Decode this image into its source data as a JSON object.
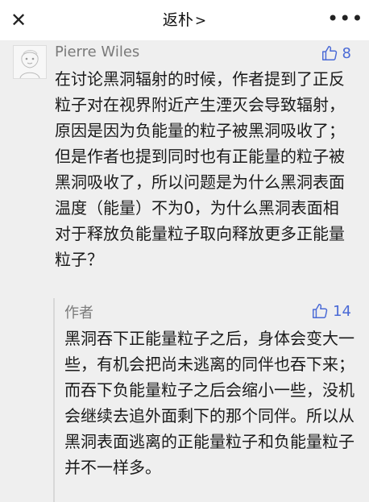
{
  "header": {
    "title": "返朴",
    "chevron": ">",
    "close_symbol": "✕",
    "more_symbol": "•••"
  },
  "comment": {
    "author": "Pierre Wiles",
    "likes": "8",
    "text": "在讨论黑洞辐射的时候，作者提到了正反粒子对在视界附近产生湮灭会导致辐射，原因是因为负能量的粒子被黑洞吸收了；但是作者也提到同时也有正能量的粒子被黑洞吸收了，所以问题是为什么黑洞表面温度（能量）不为0，为什么黑洞表面相对于释放负能量粒子取向释放更多正能量粒子？"
  },
  "reply": {
    "author": "作者",
    "likes": "14",
    "text": "黑洞吞下正能量粒子之后，身体会变大一些，有机会把尚未逃离的同伴也吞下来；而吞下负能量粒子之后会缩小一些，没机会继续去追外面剩下的那个同伴。所以从黑洞表面逃离的正能量粒子和负能量粒子并不一样多。"
  },
  "colors": {
    "accent_like": "#4a6ad6",
    "background": "#efefef",
    "muted_text": "#7a7a7a"
  },
  "icons": {
    "close": "close-icon",
    "more": "more-icon",
    "like": "thumbs-up-icon",
    "avatar": "avatar-sketch"
  }
}
